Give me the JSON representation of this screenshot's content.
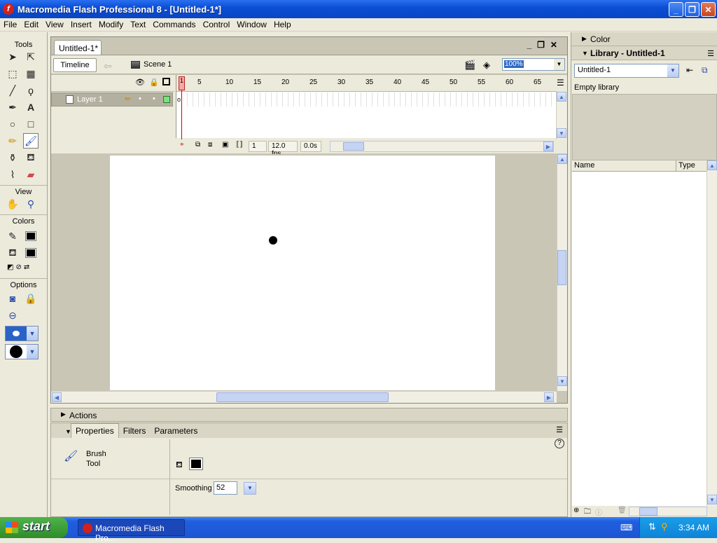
{
  "window": {
    "title": "Macromedia Flash Professional 8 - [Untitled-1*]"
  },
  "menu": [
    "File",
    "Edit",
    "View",
    "Insert",
    "Modify",
    "Text",
    "Commands",
    "Control",
    "Window",
    "Help"
  ],
  "tools_panel": {
    "title": "Tools",
    "sections": {
      "view": "View",
      "colors": "Colors",
      "options": "Options"
    }
  },
  "document": {
    "tab": "Untitled-1*",
    "timeline_button": "Timeline",
    "scene": "Scene 1",
    "zoom": "100%"
  },
  "timeline": {
    "layer_name": "Layer 1",
    "frame_numbers": [
      "1",
      "5",
      "10",
      "15",
      "20",
      "25",
      "30",
      "35",
      "40",
      "45",
      "50",
      "55",
      "60",
      "65"
    ],
    "current_frame": "1",
    "fps": "12.0 fps",
    "time": "0.0s"
  },
  "panels": {
    "actions": "Actions",
    "tabs": [
      "Properties",
      "Filters",
      "Parameters"
    ],
    "tool_name": [
      "Brush",
      "Tool"
    ],
    "smoothing_label": "Smoothing",
    "smoothing_value": "52"
  },
  "right_panel": {
    "color": "Color",
    "library_title": "Library - Untitled-1",
    "library_select": "Untitled-1",
    "empty_text": "Empty library",
    "columns": [
      "Name",
      "Type"
    ]
  },
  "taskbar": {
    "start": "start",
    "task": "Macromedia Flash Pro...",
    "clock": "3:34 AM"
  }
}
